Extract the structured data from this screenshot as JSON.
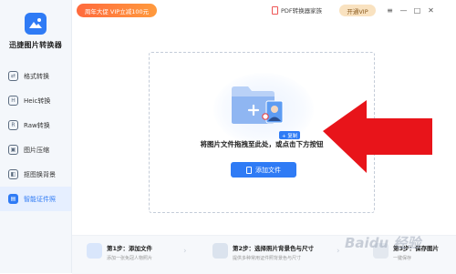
{
  "app": {
    "name": "迅捷图片转换器"
  },
  "sidebar": {
    "items": [
      {
        "label": "格式转换",
        "icon": "image-convert-icon",
        "active": false
      },
      {
        "label": "Heic转换",
        "icon": "heic-icon",
        "active": false
      },
      {
        "label": "Raw转换",
        "icon": "raw-icon",
        "active": false
      },
      {
        "label": "图片压缩",
        "icon": "compress-icon",
        "active": false
      },
      {
        "label": "抠图换背景",
        "icon": "cutout-icon",
        "active": false
      },
      {
        "label": "智能证件照",
        "icon": "id-photo-icon",
        "active": true
      }
    ]
  },
  "topbar": {
    "promo": "周年大促 VIP立减100元",
    "pdf_link": "PDF转换器家族",
    "vip_button": "开通VIP",
    "window_controls": [
      "≡",
      "—",
      "□",
      "✕"
    ]
  },
  "dropzone": {
    "drag_tag": "+ 复制",
    "instruction": "将图片文件拖拽至此处，或点击下方按钮",
    "add_button": "添加文件"
  },
  "steps": [
    {
      "title": "第1步：添加文件",
      "desc": "添加一张免冠人物照片"
    },
    {
      "title": "第2步：选择照片背景色与尺寸",
      "desc": "提供多种常用证件照背景色与尺寸"
    },
    {
      "title": "第3步：保存图片",
      "desc": "一键保存"
    }
  ],
  "watermark": "Baidu 经验",
  "colors": {
    "accent": "#2f7bf5",
    "arrow": "#e8141a",
    "promo": "#ff7a3d"
  }
}
